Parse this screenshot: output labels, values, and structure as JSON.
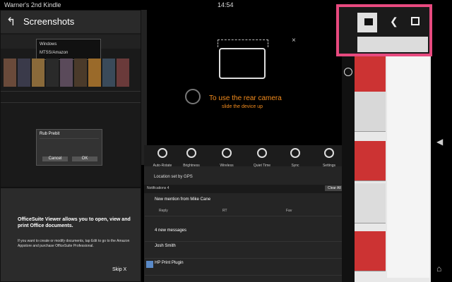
{
  "status_bar": {
    "device_name": "Warner's 2nd Kindle",
    "time": "14:54"
  },
  "screenshots_app": {
    "title": "Screenshots",
    "dialog": {
      "title": "Rub Prebit",
      "cancel": "Cancel",
      "ok": "OK"
    },
    "dropdown": {
      "item1": "Windows",
      "item2": "MTSS/Amazon"
    }
  },
  "officesuite": {
    "heading": "OfficeSuite Viewer allows you to open, view and print Office documents.",
    "body": "If you want to create or modify documents, tap Edit to go to the Amazon Appstore and purchase OfficeSuite Professional.",
    "skip": "Skip X"
  },
  "camera_tip": {
    "title": "To use the rear camera",
    "subtitle": "slide the device up"
  },
  "quick_settings": {
    "buttons": [
      "Auto-Rotate",
      "Brightness",
      "Wireless",
      "Quiet Time",
      "Sync",
      "Settings"
    ],
    "location": "Location set by GPS",
    "notifications_label": "Notifications 4",
    "clear_all": "Clear All",
    "items": [
      "New mention from Mike Cane",
      "4 new messages",
      "Josh Smith",
      "HP Print Plugin"
    ],
    "actions": [
      "Reply",
      "RT",
      "Fav"
    ]
  },
  "share_toolbar": {
    "icons": [
      "camera-icon",
      "share-icon",
      "checkbox-icon"
    ]
  },
  "colors": {
    "highlight": "#e84a7f",
    "camera_orange": "#f28b1d"
  }
}
